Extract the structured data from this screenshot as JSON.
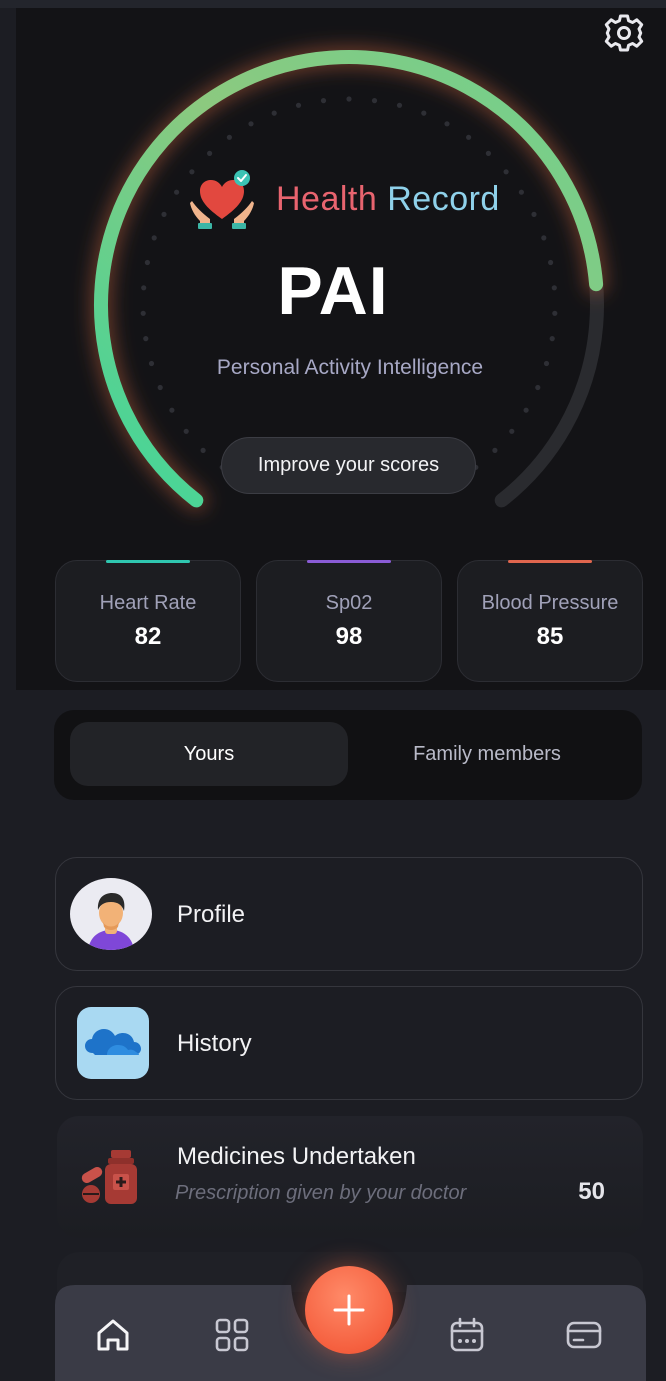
{
  "hero": {
    "brand_part1": "Health ",
    "brand_part2": "Record",
    "title": "PAI",
    "subtitle": "Personal Activity Intelligence",
    "improve_button": "Improve your scores",
    "gauge_level": 0.8
  },
  "metrics": [
    {
      "label": "Heart Rate",
      "value": "82",
      "accent": "#2fc7b0"
    },
    {
      "label": "Sp02",
      "value": "98",
      "accent": "#8a5cd6"
    },
    {
      "label": "Blood Pressure",
      "value": "85",
      "accent": "#e0664e"
    }
  ],
  "tabs": {
    "yours": "Yours",
    "family": "Family members",
    "selected": "Yours"
  },
  "cards": {
    "profile": "Profile",
    "history": "History",
    "medicines": {
      "title": "Medicines Undertaken",
      "subtitle": "Prescription given by your doctor",
      "count": "50"
    }
  },
  "nav": {
    "items": [
      "home-icon",
      "grid-icon",
      "add-icon",
      "calendar-icon",
      "card-icon"
    ],
    "active": "home-icon",
    "fab_color": "#f5603f"
  },
  "colors": {
    "gauge_start": "#3fd69a",
    "gauge_end": "#b4c97a",
    "brand_red": "#e8646f",
    "brand_blue": "#8fd1ea"
  }
}
